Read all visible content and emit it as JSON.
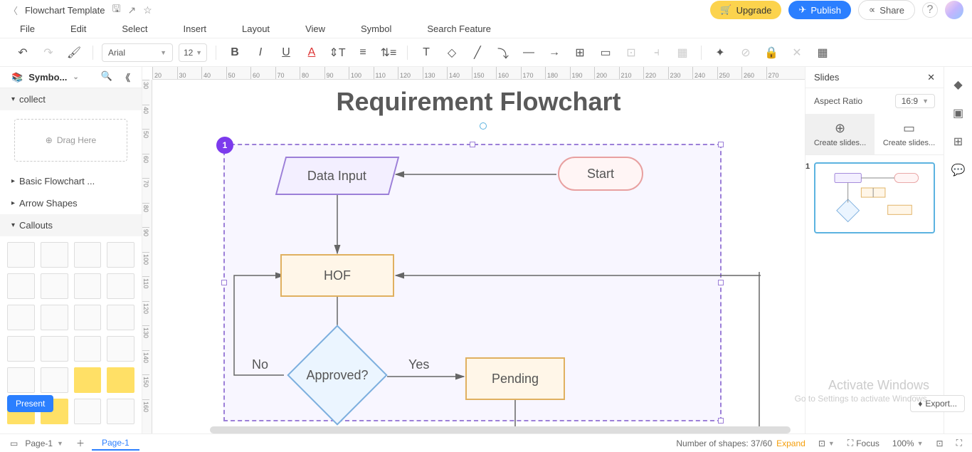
{
  "titlebar": {
    "name": "Flowchart Template",
    "upgrade": "Upgrade",
    "publish": "Publish",
    "share": "Share"
  },
  "menu": {
    "file": "File",
    "edit": "Edit",
    "select": "Select",
    "insert": "Insert",
    "layout": "Layout",
    "view": "View",
    "symbol": "Symbol",
    "search": "Search Feature"
  },
  "toolbar": {
    "font": "Arial",
    "size": "12"
  },
  "sidebar": {
    "title": "Symbo...",
    "collect": "collect",
    "drag": "Drag Here",
    "basic": "Basic Flowchart ...",
    "arrow": "Arrow Shapes",
    "callouts": "Callouts"
  },
  "chart_data": {
    "type": "flowchart",
    "title": "Requirement Flowchart",
    "nodes": [
      {
        "id": "start",
        "type": "terminator",
        "label": "Start"
      },
      {
        "id": "data_input",
        "type": "data",
        "label": "Data Input"
      },
      {
        "id": "hof",
        "type": "process",
        "label": "HOF"
      },
      {
        "id": "approved",
        "type": "decision",
        "label": "Approved?"
      },
      {
        "id": "pending",
        "type": "process",
        "label": "Pending"
      }
    ],
    "edges": [
      {
        "from": "start",
        "to": "data_input"
      },
      {
        "from": "data_input",
        "to": "hof"
      },
      {
        "from": "hof",
        "to": "approved"
      },
      {
        "from": "approved",
        "to": "pending",
        "label": "Yes"
      },
      {
        "from": "approved",
        "to": "hof",
        "label": "No",
        "route": "left-up"
      },
      {
        "from": "hof",
        "to": "right-edge",
        "route": "feedback"
      }
    ],
    "selection_badge": "1"
  },
  "rpanel": {
    "title": "Slides",
    "aspect": "Aspect Ratio",
    "ratio": "16:9",
    "create1": "Create slides...",
    "create2": "Create slides...",
    "slide_num": "1",
    "present": "Present",
    "export": "Export..."
  },
  "status": {
    "page_sel": "Page-1",
    "page_tab": "Page-1",
    "shapes_label": "Number of shapes:",
    "shapes_count": "37/60",
    "expand": "Expand",
    "focus": "Focus",
    "zoom": "100%"
  },
  "watermark": {
    "title": "Activate Windows",
    "sub": "Go to Settings to activate Windows."
  },
  "ruler_h": [
    "20",
    "30",
    "40",
    "50",
    "60",
    "70",
    "80",
    "90",
    "100",
    "110",
    "120",
    "130",
    "140",
    "150",
    "160",
    "170",
    "180",
    "190",
    "200",
    "210",
    "220",
    "230",
    "240",
    "250",
    "260",
    "270"
  ],
  "ruler_v": [
    "30",
    "40",
    "50",
    "60",
    "70",
    "80",
    "90",
    "100",
    "110",
    "120",
    "130",
    "140",
    "150",
    "160"
  ]
}
